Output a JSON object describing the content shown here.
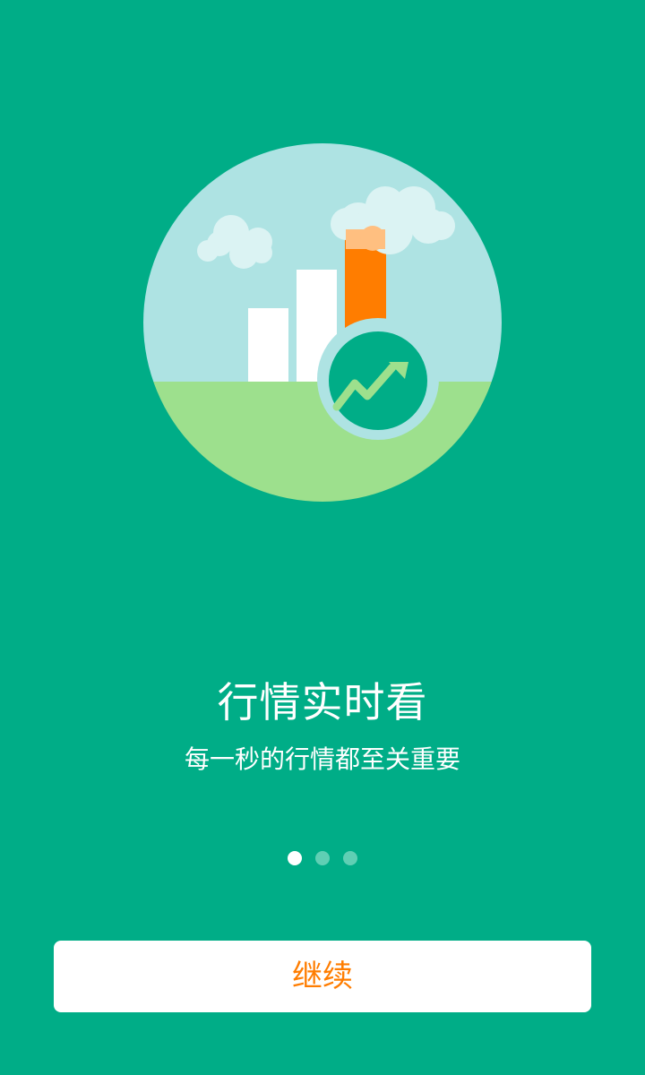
{
  "onboarding": {
    "headline": "行情实时看",
    "subtitle": "每一秒的行情都至关重要",
    "continue_label": "继续",
    "pager": {
      "page_count": 3,
      "current_page": 1
    },
    "illustration": {
      "icon": "market-rise-chart-icon",
      "colors": {
        "sky": "#aee3e3",
        "grass": "#9de08d",
        "bar_white": "#ffffff",
        "bar_orange": "#ff7d00",
        "cloud": "#dbf3f3",
        "trend_badge": "#00ad87",
        "trend_arrow": "#9de08d"
      }
    }
  },
  "theme": {
    "background": "#00ad87",
    "accent": "#ff7d00",
    "text": "#ffffff",
    "dot_inactive": "#5fcfb4",
    "dot_active": "#ffffff"
  }
}
